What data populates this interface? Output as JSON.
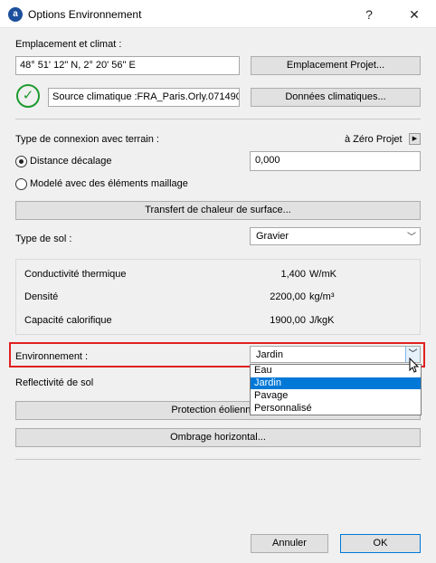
{
  "window": {
    "title": "Options Environnement",
    "help_label": "?",
    "close_label": "✕"
  },
  "location": {
    "heading": "Emplacement et climat :",
    "coordinates": "48° 51' 12\" N, 2° 20' 56\" E",
    "project_location_button": "Emplacement Projet...",
    "climate_source": "Source climatique :FRA_Paris.Orly.071490",
    "climate_data_button": "Données climatiques..."
  },
  "ground": {
    "connection_heading": "Type de connexion avec terrain :",
    "zero_label": "à Zéro Projet",
    "radio_offset_label": "Distance décalage",
    "offset_value": "0,000",
    "radio_mesh_label": "Modelé avec des éléments maillage",
    "surface_heat_button": "Transfert de chaleur de surface...",
    "soil_type_label": "Type de sol :",
    "soil_type_value": "Gravier"
  },
  "properties": {
    "conductivity_label": "Conductivité thermique",
    "conductivity_value": "1,400",
    "conductivity_unit": "W/mK",
    "density_label": "Densité",
    "density_value": "2200,00",
    "density_unit": "kg/m³",
    "heat_capacity_label": "Capacité calorifique",
    "heat_capacity_value": "1900,00",
    "heat_capacity_unit": "J/kgK"
  },
  "environment": {
    "label": "Environnement :",
    "selected": "Jardin",
    "options": [
      "Eau",
      "Jardin",
      "Pavage",
      "Personnalisé"
    ]
  },
  "reflectivity": {
    "label": "Reflectivité de sol",
    "wind_protection_button": "Protection éolienne...",
    "horizontal_shading_button": "Ombrage horizontal..."
  },
  "footer": {
    "cancel_button": "Annuler",
    "ok_button": "OK"
  }
}
